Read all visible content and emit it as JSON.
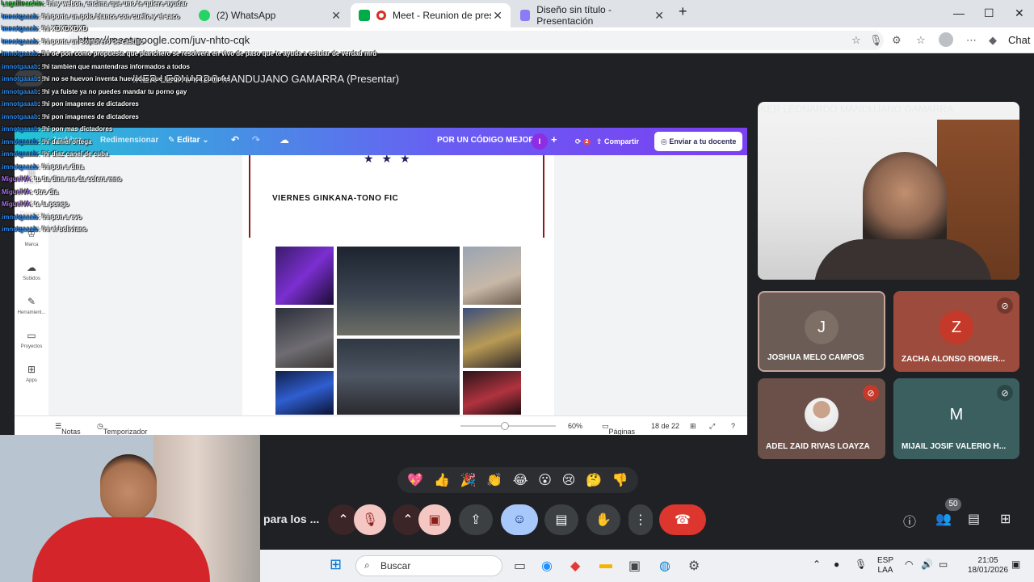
{
  "browser": {
    "tabs": [
      {
        "label": "(2) WhatsApp"
      },
      {
        "label": "Meet - Reunion de presentaci"
      },
      {
        "label": "Diseño sin título - Presentación"
      }
    ],
    "url": "https://meet.google.com/juv-nhto-cqk",
    "chat_label": "Chat"
  },
  "meet": {
    "presenter_label": "IKER LEONARDO MANDUJANO GAMARRA (Presentar)",
    "meeting_title": "para los ...",
    "participant_count": "50",
    "main_speaker": "IKER LEONARDO MANDUJANO GAMARRA",
    "participants": [
      {
        "initial": "J",
        "name": "JOSHUA MELO CAMPOS",
        "color": "#6b5c55",
        "avatar_color": "#7d6e66"
      },
      {
        "initial": "Z",
        "name": "ZACHA ALONSO ROMER...",
        "color": "#9c4b3c",
        "avatar_color": "#c5392a"
      },
      {
        "initial": "",
        "name": "ADEL ZAID RIVAS LOAYZA",
        "color": "#6a5048",
        "avatar_color": "#e8e8e8"
      },
      {
        "initial": "M",
        "name": "MIJAIL JOSIF VALERIO H...",
        "color": "#3b5f5f",
        "avatar_color": "#3b5f5f"
      }
    ],
    "reactions": [
      "💖",
      "👍",
      "🎉",
      "👏",
      "😂",
      "😮",
      "😢",
      "🤔",
      "👎"
    ]
  },
  "canva": {
    "menu": {
      "archivo": "Archivo",
      "redimensionar": "Redimensionar",
      "editar": "Editar",
      "project_name": "POR UN CÓDIGO MEJOR",
      "avatar_initial": "I",
      "comments_count": "2",
      "share": "Compartir",
      "send": "Enviar a tu docente"
    },
    "sidebar": [
      "Diseño",
      "Elementos",
      "Marca",
      "Subidos",
      "Herramient...",
      "Proyectos",
      "Apps"
    ],
    "slide_heading": "VIERNES GINKANA-TONO FIC",
    "bottom": {
      "notes": "Notas",
      "timer": "Temporizador",
      "zoom": "60%",
      "pages": "Páginas",
      "page_info": "18 de 22"
    }
  },
  "chat_overlay": [
    {
      "user": "Lagallinachin",
      "msg": ": !hi y webon, encima que uno te quiere ayudar"
    },
    {
      "user": "imnotgaaab",
      "msg": ": !hi ponte un polo blanco con cuello y el saco"
    },
    {
      "user": "imnotgaaab",
      "msg": ": !hi XDXDXDXD"
    },
    {
      "user": "imnotgaaab",
      "msg": ": !hi ponte un sombrero de castillo"
    },
    {
      "user": "imnotgaaab",
      "msg": ": !hi oe pon como propuesta que planchero se resolvera en vivo de paso que te ayuda a estuiar de verdad mrd"
    },
    {
      "user": "imnotgaaab",
      "msg": ": !hi tambien que mantendras informados a todos"
    },
    {
      "user": "imnotgaaab",
      "msg": ": !hi no se huevon inventa huevadas que luego nunca cumples"
    },
    {
      "user": "imnotgaaab",
      "msg": ": !hi ya fuiste ya no puedes mandar tu porno gay"
    },
    {
      "user": "imnotgaaab",
      "msg": ": !hi pon imagenes de dictadores"
    },
    {
      "user": "imnotgaaab",
      "msg": ": !hi pon imagenes de dictadores"
    },
    {
      "user": "imnotgaaab",
      "msg": ": !hi pon mas dictadores"
    },
    {
      "user": "imnotgaaab",
      "msg": ": !hi daniel ortega"
    },
    {
      "user": "imnotgaaab",
      "msg": ": !hi diaz canel de cuba"
    },
    {
      "user": "imnotgaaab",
      "msg": ": !hi pon a dina"
    },
    {
      "user": "MiguelVA",
      "msg": ": tu tia dina me da colera mno"
    },
    {
      "user": "MiguelVA",
      "msg": ": otro dia"
    },
    {
      "user": "MiguelVA",
      "msg": ": te la pongo"
    },
    {
      "user": "imnotgaaab",
      "msg": ": !hi pon a evo"
    },
    {
      "user": "imnotgaaab",
      "msg": ": !hi el boliviano"
    }
  ],
  "taskbar": {
    "search_placeholder": "Buscar",
    "lang_top": "ESP",
    "lang_bottom": "LAA",
    "time": "21:05",
    "date": "18/01/2026"
  }
}
